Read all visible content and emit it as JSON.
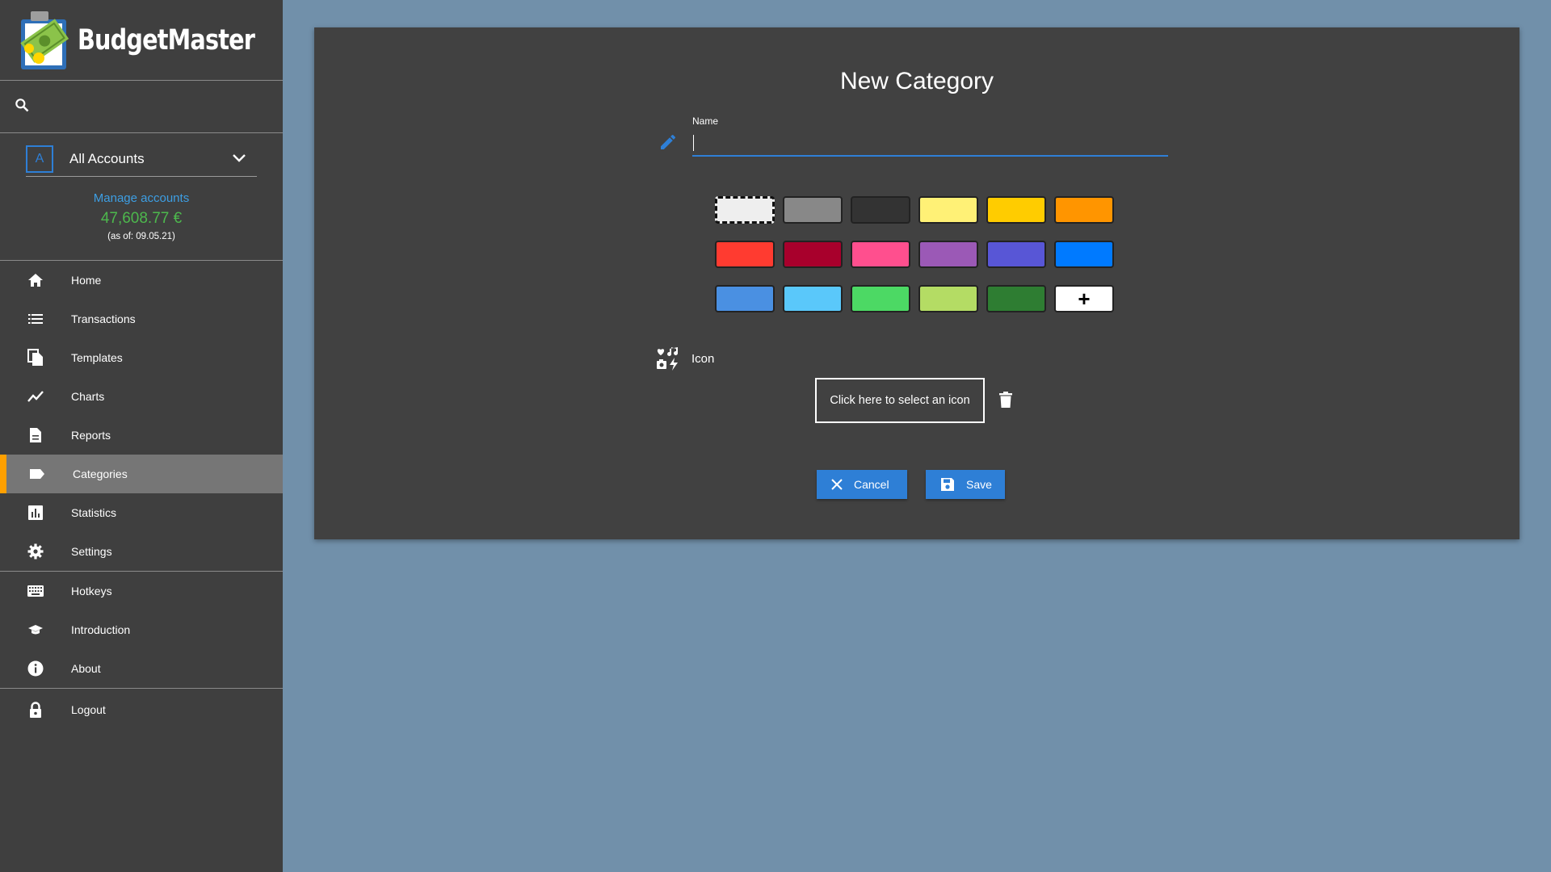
{
  "app": {
    "name": "BudgetMaster"
  },
  "sidebar": {
    "account": {
      "badge": "A",
      "name": "All Accounts"
    },
    "manage_accounts": "Manage accounts",
    "balance": "47,608.77 €",
    "as_of": "(as of: 09.05.21)",
    "items": [
      {
        "label": "Home",
        "icon": "home-icon"
      },
      {
        "label": "Transactions",
        "icon": "list-icon"
      },
      {
        "label": "Templates",
        "icon": "file-copy-icon"
      },
      {
        "label": "Charts",
        "icon": "line-chart-icon"
      },
      {
        "label": "Reports",
        "icon": "document-icon"
      },
      {
        "label": "Categories",
        "icon": "label-icon",
        "active": true
      },
      {
        "label": "Statistics",
        "icon": "bar-chart-icon"
      },
      {
        "label": "Settings",
        "icon": "gear-icon"
      }
    ],
    "items2": [
      {
        "label": "Hotkeys",
        "icon": "keyboard-icon"
      },
      {
        "label": "Introduction",
        "icon": "graduation-cap-icon"
      },
      {
        "label": "About",
        "icon": "info-icon"
      }
    ],
    "logout": {
      "label": "Logout",
      "icon": "lock-icon"
    }
  },
  "form": {
    "title": "New Category",
    "name_label": "Name",
    "name_value": "",
    "colors": [
      "#eeeeee",
      "#888888",
      "#333333",
      "#fff176",
      "#ffcc00",
      "#ff9500",
      "#ff3b30",
      "#a8002c",
      "#ff4f8e",
      "#9b59b6",
      "#5856d6",
      "#007aff",
      "#4a90e2",
      "#5ac8fa",
      "#4cd964",
      "#b4dc64",
      "#2e7d32"
    ],
    "selected_color": "#eeeeee",
    "add_color_symbol": "+",
    "icon_label": "Icon",
    "select_icon_button": "Click here to select an icon",
    "cancel_label": "Cancel",
    "save_label": "Save"
  },
  "theme": {
    "accent": "#2e7fd6",
    "active_indicator": "#ffa000",
    "balance_color": "#4db84d"
  }
}
